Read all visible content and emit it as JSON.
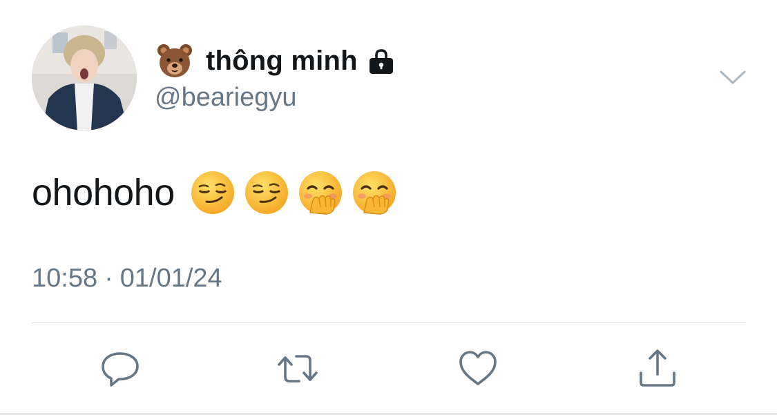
{
  "author": {
    "display_name": "thông minh",
    "handle": "@beariegyu",
    "name_emoji": "bear-face",
    "protected_icon": "lock-icon",
    "avatar": "profile-photo"
  },
  "tweet": {
    "text": "ohohoho",
    "emojis": [
      "smirking-face",
      "smirking-face",
      "face-with-hand-over-mouth",
      "face-with-hand-over-mouth"
    ],
    "time": "10:58",
    "separator": "·",
    "date": "01/01/24"
  },
  "actions": [
    "reply",
    "retweet",
    "like",
    "share"
  ],
  "colors": {
    "primary_text": "#14171a",
    "secondary_text": "#657786",
    "divider": "#dfe3e7",
    "icon": "#657786"
  }
}
